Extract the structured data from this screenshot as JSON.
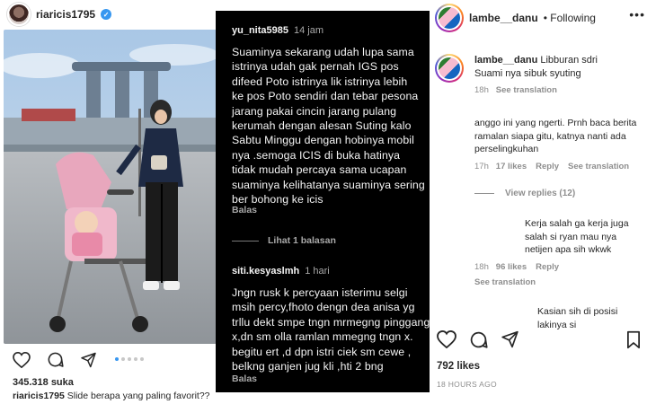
{
  "left_post": {
    "username": "riaricis1795",
    "likes": "345.318 suka",
    "caption_user": "riaricis1795",
    "caption_text": "Slide berapa yang paling favorit??",
    "carousel_total": 5,
    "carousel_active": 0
  },
  "middle_comments": {
    "comment1": {
      "user": "yu_nita5985",
      "time": "14 jam",
      "text": "Suaminya sekarang udah lupa sama\nistrinya udah gak pernah IGS pos\ndifeed Poto istrinya lik istrinya lebih\nke pos Poto sendiri dan tebar pesona\njarang pakai cincin jarang pulang\nkerumah dengan alesan Suting kalo\nSabtu Minggu dengan hobinya mobil\nnya .semoga ICIS di buka hatinya\ntidak mudah percaya sama ucapan\nsuaminya kelihatanya suaminya sering\nber bohong ke icis",
      "reply": "Balas"
    },
    "view_replies": "Lihat 1 balasan",
    "comment2": {
      "user": "siti.kesyaslmh",
      "time": "1 hari",
      "text": "Jngn rusk k percyaan isterimu selgi\nmsih percy,fhoto dengn dea anisa yg\ntrllu dekt smpe tngn mrmegng pinggang\nx,dn sm olla ramlan mmegng tngn x.\nbegitu ert ,d dpn istri ciek sm cewe ,\nbelkng ganjen jug kli ,hti 2 bng",
      "reply": "Balas"
    }
  },
  "right_post": {
    "username": "lambe__danu",
    "following": "Following",
    "caption_user": "lambe__danu",
    "caption_text": "Libburan sdri",
    "caption_text2": "Suami nya sibuk syuting",
    "caption_time": "18h",
    "see_translation": "See translation",
    "comments": [
      {
        "text": "anggo ini yang ngerti. Prnh baca berita ramalan siapa gitu, katnya nanti ada perselingkuhan",
        "time": "17h",
        "likes": "17 likes",
        "reply": "Reply",
        "translate": "See translation"
      },
      {
        "text": "Kerja salah ga kerja juga salah si ryan mau nya netijen apa sih wkwk",
        "time": "18h",
        "likes": "96 likes",
        "reply": "Reply",
        "translate": "See translation"
      },
      {
        "text": "Kasian sih di posisi lakinya si"
      }
    ],
    "view_replies": "View replies (12)",
    "likes": "792 likes",
    "timestamp": "18 HOURS AGO"
  }
}
